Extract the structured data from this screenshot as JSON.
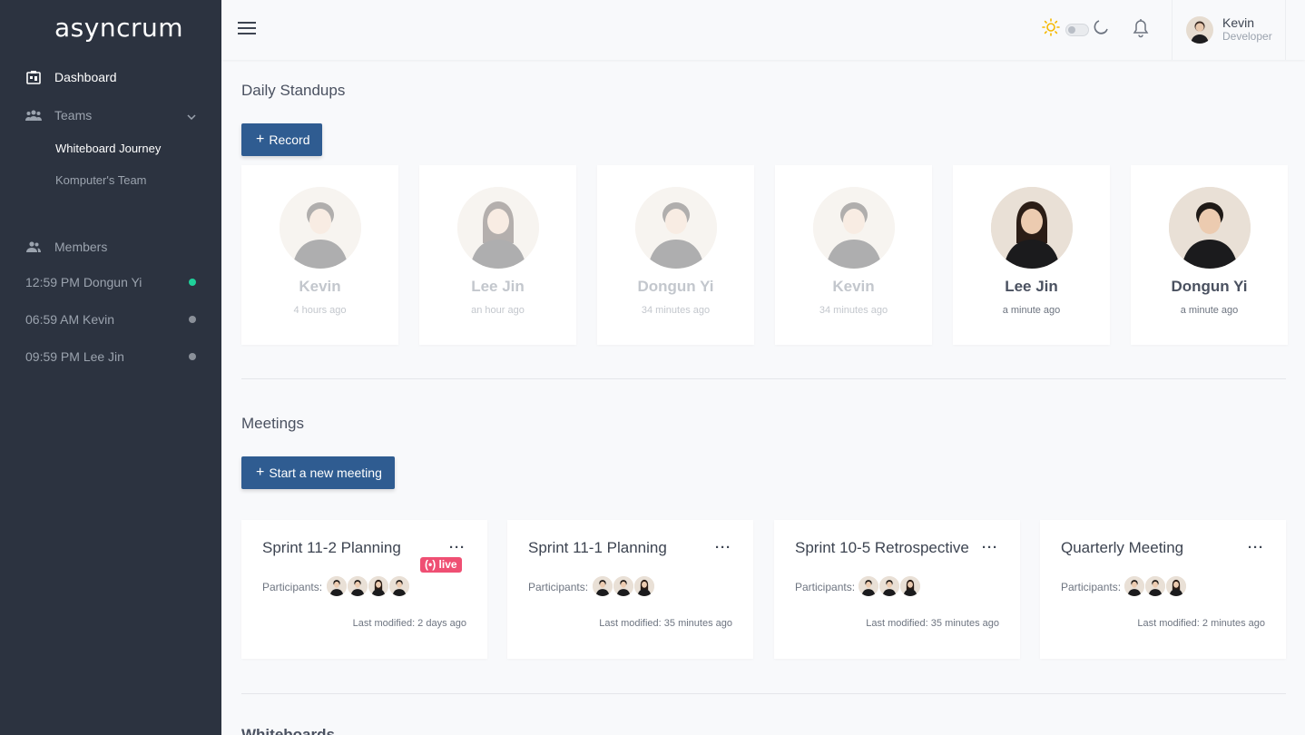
{
  "sidebar": {
    "logo": "asyncrum",
    "dashboard": "Dashboard",
    "teams": "Teams",
    "team_items": [
      "Whiteboard Journey",
      "Komputer's Team"
    ],
    "members_label": "Members",
    "members": [
      {
        "label": "12:59 PM Dongun Yi",
        "online": true
      },
      {
        "label": "06:59 AM Kevin",
        "online": false
      },
      {
        "label": "09:59 PM Lee Jin",
        "online": false
      }
    ]
  },
  "topbar": {
    "user_name": "Kevin",
    "user_role": "Developer",
    "icons": [
      "hamburger-icon",
      "sun-icon",
      "moon-icon",
      "bell-icon"
    ]
  },
  "standups": {
    "title": "Daily Standups",
    "record_button": "Record",
    "items": [
      {
        "name": "Kevin",
        "time": "4 hours ago",
        "viewed": true
      },
      {
        "name": "Lee Jin",
        "time": "an hour ago",
        "viewed": true
      },
      {
        "name": "Dongun Yi",
        "time": "34 minutes ago",
        "viewed": true
      },
      {
        "name": "Kevin",
        "time": "34 minutes ago",
        "viewed": true
      },
      {
        "name": "Lee Jin",
        "time": "a minute ago",
        "viewed": false
      },
      {
        "name": "Dongun Yi",
        "time": "a minute ago",
        "viewed": false
      }
    ]
  },
  "meetings": {
    "title": "Meetings",
    "new_button": "Start a new meeting",
    "participants_label": "Participants:",
    "live_label": "live",
    "items": [
      {
        "title": "Sprint 11-2 Planning",
        "live": true,
        "participants": 4,
        "modified": "Last modified: 2 days ago"
      },
      {
        "title": "Sprint 11-1 Planning",
        "live": false,
        "participants": 3,
        "modified": "Last modified: 35 minutes ago"
      },
      {
        "title": "Sprint 10-5 Retrospective",
        "live": false,
        "participants": 3,
        "modified": "Last modified: 35 minutes ago"
      },
      {
        "title": "Quarterly Meeting",
        "live": false,
        "participants": 3,
        "modified": "Last modified: 2 minutes ago"
      }
    ]
  },
  "whiteboards": {
    "title": "Whiteboards"
  },
  "colors": {
    "sidebar_bg": "#2c3340",
    "primary": "#2f5c91",
    "live": "#ef4f73",
    "online": "#1fd19a"
  }
}
